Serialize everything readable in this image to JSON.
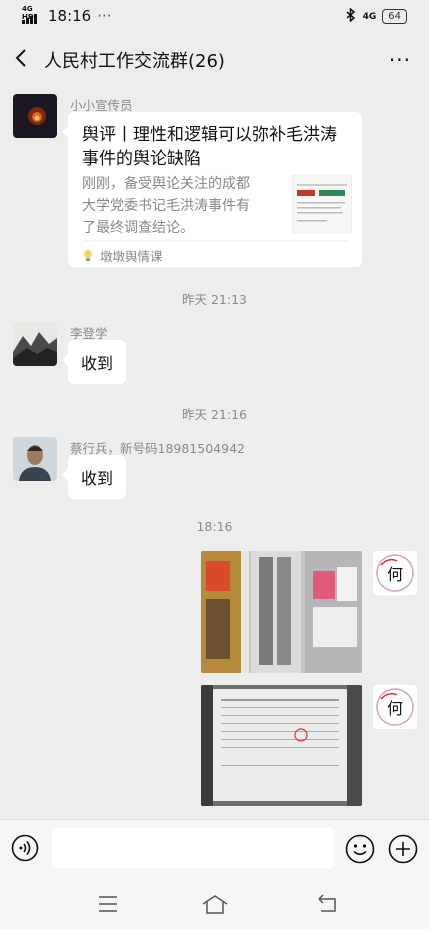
{
  "status": {
    "network": "4G HD",
    "time": "18:16",
    "notif": "···",
    "net_right": "4G",
    "battery": "64"
  },
  "header": {
    "title": "人民村工作交流群(26)",
    "more": "···"
  },
  "messages": {
    "m1": {
      "sender": "小小宣传员",
      "card_title": "舆评丨理性和逻辑可以弥补毛洪涛事件的舆论缺陷",
      "card_desc": "刚刚，备受舆论关注的成都大学党委书记毛洪涛事件有了最终调查结论。",
      "source": "墩墩舆情课"
    },
    "t1": "昨天 21:13",
    "m2": {
      "sender": "李登学",
      "text": "收到"
    },
    "t2": "昨天 21:16",
    "m3": {
      "sender": "蔡行兵，新号码18981504942",
      "text": "收到"
    },
    "t3": "18:16",
    "m4": {
      "self_avatar_char": "何"
    },
    "m5": {
      "self_avatar_char": "何"
    }
  }
}
